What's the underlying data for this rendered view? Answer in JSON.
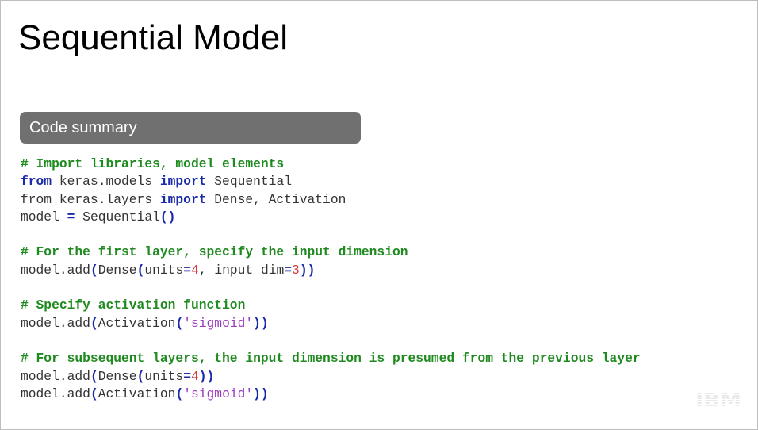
{
  "slide": {
    "title": "Sequential Model",
    "banner": "Code summary",
    "logo_text": "IBM"
  },
  "code": {
    "lines": [
      [
        {
          "t": "comment",
          "v": "# Import libraries, model elements"
        }
      ],
      [
        {
          "t": "keyword",
          "v": "from"
        },
        {
          "t": "plain",
          "v": " keras.models "
        },
        {
          "t": "keyword",
          "v": "import"
        },
        {
          "t": "plain",
          "v": " Sequential"
        }
      ],
      [
        {
          "t": "plain",
          "v": "from keras.layers "
        },
        {
          "t": "keyword",
          "v": "import"
        },
        {
          "t": "plain",
          "v": " Dense, Activation"
        }
      ],
      [
        {
          "t": "plain",
          "v": "model "
        },
        {
          "t": "op",
          "v": "="
        },
        {
          "t": "plain",
          "v": " Sequential"
        },
        {
          "t": "op",
          "v": "()"
        }
      ],
      [],
      [
        {
          "t": "comment",
          "v": "# For the first layer, specify the input dimension"
        }
      ],
      [
        {
          "t": "plain",
          "v": "model.add"
        },
        {
          "t": "op",
          "v": "("
        },
        {
          "t": "plain",
          "v": "Dense"
        },
        {
          "t": "op",
          "v": "("
        },
        {
          "t": "plain",
          "v": "units"
        },
        {
          "t": "op",
          "v": "="
        },
        {
          "t": "number",
          "v": "4"
        },
        {
          "t": "plain",
          "v": ", input_dim"
        },
        {
          "t": "op",
          "v": "="
        },
        {
          "t": "number",
          "v": "3"
        },
        {
          "t": "op",
          "v": "))"
        }
      ],
      [],
      [
        {
          "t": "comment",
          "v": "# Specify activation function"
        }
      ],
      [
        {
          "t": "plain",
          "v": "model.add"
        },
        {
          "t": "op",
          "v": "("
        },
        {
          "t": "plain",
          "v": "Activation"
        },
        {
          "t": "op",
          "v": "("
        },
        {
          "t": "string",
          "v": "'sigmoid'"
        },
        {
          "t": "op",
          "v": "))"
        }
      ],
      [],
      [
        {
          "t": "comment",
          "v": "# For subsequent layers, the input dimension is presumed from the previous layer"
        }
      ],
      [
        {
          "t": "plain",
          "v": "model.add"
        },
        {
          "t": "op",
          "v": "("
        },
        {
          "t": "plain",
          "v": "Dense"
        },
        {
          "t": "op",
          "v": "("
        },
        {
          "t": "plain",
          "v": "units"
        },
        {
          "t": "op",
          "v": "="
        },
        {
          "t": "number",
          "v": "4"
        },
        {
          "t": "op",
          "v": "))"
        }
      ],
      [
        {
          "t": "plain",
          "v": "model.add"
        },
        {
          "t": "op",
          "v": "("
        },
        {
          "t": "plain",
          "v": "Activation"
        },
        {
          "t": "op",
          "v": "("
        },
        {
          "t": "string",
          "v": "'sigmoid'"
        },
        {
          "t": "op",
          "v": "))"
        }
      ]
    ]
  },
  "colors": {
    "comment": "#1f8a1f",
    "keyword": "#1b2aa8",
    "number": "#d8363b",
    "string": "#9a3bbf",
    "banner_bg": "#707070",
    "logo": "#1a1a1a"
  }
}
